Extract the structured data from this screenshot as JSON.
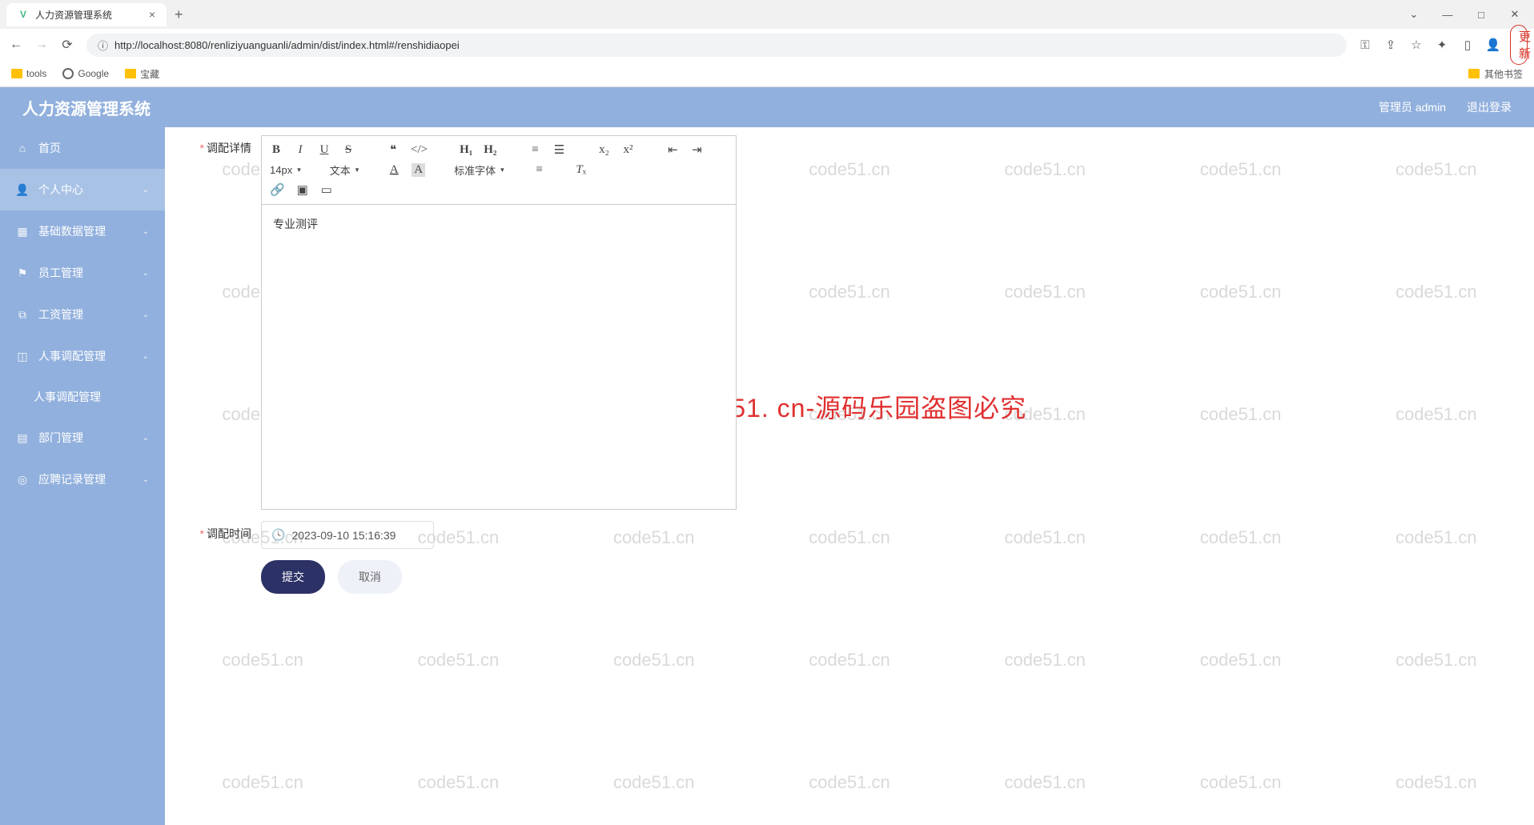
{
  "browser": {
    "tab_title": "人力资源管理系统",
    "url": "http://localhost:8080/renliziyuanguanli/admin/dist/index.html#/renshidiaopei",
    "update_label": "更新",
    "bookmarks": {
      "tools": "tools",
      "google": "Google",
      "treasure": "宝藏",
      "other": "其他书签"
    }
  },
  "app": {
    "title": "人力资源管理系统",
    "user_label": "管理员 admin",
    "logout": "退出登录"
  },
  "sidebar": {
    "items": [
      {
        "label": "首页",
        "icon": "home"
      },
      {
        "label": "个人中心",
        "icon": "user"
      },
      {
        "label": "基础数据管理",
        "icon": "grid"
      },
      {
        "label": "员工管理",
        "icon": "flag"
      },
      {
        "label": "工资管理",
        "icon": "copy"
      },
      {
        "label": "人事调配管理",
        "icon": "hr"
      },
      {
        "label": "部门管理",
        "icon": "dept"
      },
      {
        "label": "应聘记录管理",
        "icon": "record"
      }
    ],
    "submenu": "人事调配管理"
  },
  "form": {
    "detail_label": "调配详情",
    "time_label": "调配时间",
    "time_value": "2023-09-10 15:16:39",
    "editor_content": "专业测评",
    "toolbar": {
      "font_size": "14px",
      "text_type": "文本",
      "font_family": "标准字体"
    },
    "submit": "提交",
    "cancel": "取消"
  },
  "watermark": {
    "text": "code51.cn",
    "center": "code51. cn-源码乐园盗图必究"
  }
}
